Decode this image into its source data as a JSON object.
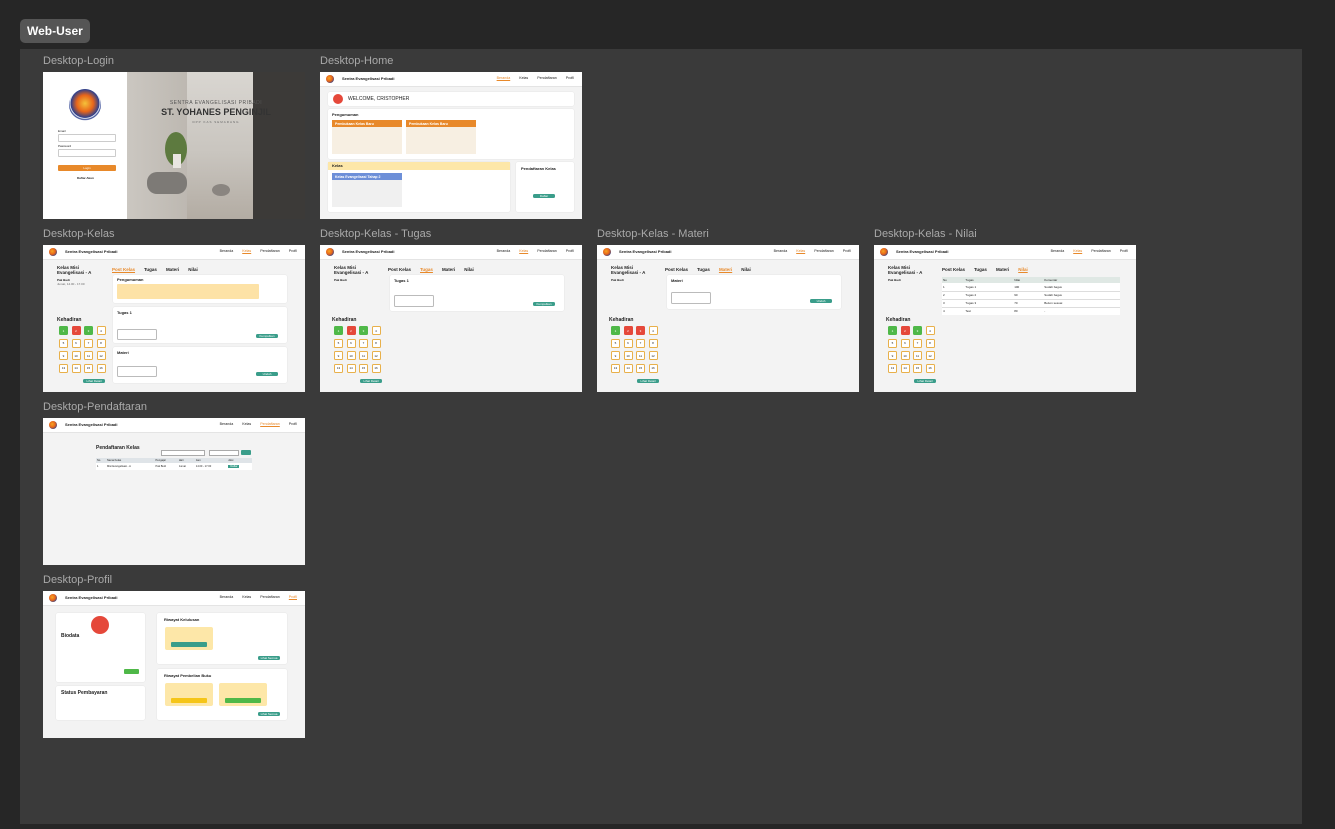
{
  "section": {
    "title": "Web-User"
  },
  "frames": {
    "login": "Desktop-Login",
    "home": "Desktop-Home",
    "kelas": "Desktop-Kelas",
    "tugas": "Desktop-Kelas - Tugas",
    "materi": "Desktop-Kelas - Materi",
    "nilai": "Desktop-Kelas - Nilai",
    "pendaftaran": "Desktop-Pendaftaran",
    "profil": "Desktop-Profil"
  },
  "colors": {
    "accent": "#e8892a",
    "success": "#3a9d8a",
    "canvas": "#3a3a3a"
  },
  "common": {
    "brand": "Sentra Evangelisasi Pribadi",
    "nav": [
      "Beranda",
      "Kelas",
      "Pendaftaran",
      "Profil"
    ],
    "kehadiran": "Kehadiran",
    "lihat_detail": "Lihat Detail",
    "class_title": "Kelas Misi Evangelisasi - A",
    "teacher": "Pak Budi",
    "schedule": "Jumat, 14.00 - 17.00",
    "tabs": [
      "Post Kelas",
      "Tugas",
      "Materi",
      "Nilai"
    ],
    "attendance": [
      "1",
      "2",
      "3",
      "4",
      "5",
      "6",
      "7",
      "8",
      "9",
      "10",
      "11",
      "12",
      "13",
      "14",
      "15",
      "16"
    ]
  },
  "login": {
    "hero_small": "SENTRA EVANGELISASI PRIBADI",
    "hero_title": "ST. YOHANES PENGINJIL",
    "hero_sub": "DPP KAS SEMARANG",
    "email_label": "Email",
    "password_label": "Password",
    "forgot": "Forgot Password?",
    "login_button": "Login",
    "register": "Daftar Akun"
  },
  "home": {
    "welcome": "WELCOME, CRISTOPHER",
    "pengumuman": "Pengumuman",
    "ann1": "Pembukaan Kelas Baru",
    "ann2": "Pembukaan Kelas Baru",
    "kelas": "Kelas",
    "kelas_card": "Kelas Evangelisasi Tahap 2",
    "pendaftaran": "Pendaftaran Kelas",
    "daftar": "Daftar"
  },
  "kelas": {
    "pengumuman": "Pengumuman",
    "tugas1": "Tugas 1",
    "materi": "Materi",
    "kumpulkan": "Kumpulkan",
    "unduh": "Unduh"
  },
  "nilai": {
    "headers": [
      "No",
      "Tugas",
      "Nilai",
      "Komentar"
    ],
    "rows": [
      [
        "1",
        "Tugas 1",
        "100",
        "Sudah bagus"
      ],
      [
        "2",
        "Tugas 2",
        "90",
        "Sudah bagus"
      ],
      [
        "3",
        "Tugas 3",
        "70",
        "Belum sesuai"
      ],
      [
        "4",
        "Test",
        "80",
        "-"
      ]
    ]
  },
  "pendaftaran": {
    "title": "Pendaftaran Kelas",
    "headers": [
      "No",
      "Nama Kelas",
      "Pengajar",
      "Hari",
      "Jam",
      "Aksi"
    ],
    "row": [
      "1",
      "Misi Evangelisasi - A",
      "Pak Budi",
      "Jumat",
      "14.00 - 17.00",
      "Daftar"
    ]
  },
  "profil": {
    "biodata": "Biodata",
    "riwayat_kelulusan": "Riwayat Kelulusan",
    "riwayat_buku": "Riwayat Pembelian Buku",
    "status_pembayaran": "Status Pembayaran",
    "lihat_semua": "Lihat Semua"
  }
}
